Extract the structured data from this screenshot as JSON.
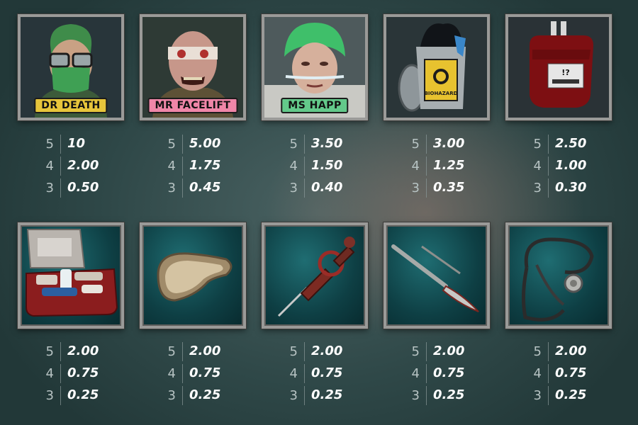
{
  "symbols_row1": [
    {
      "name": "dr-death",
      "label": "DR DEATH",
      "label_color": "#e7c53b",
      "payouts": [
        {
          "count": "5",
          "value": "10"
        },
        {
          "count": "4",
          "value": "2.00"
        },
        {
          "count": "3",
          "value": "0.50"
        }
      ]
    },
    {
      "name": "mr-facelift",
      "label": "MR FACELIFT",
      "label_color": "#ef86a8",
      "payouts": [
        {
          "count": "5",
          "value": "5.00"
        },
        {
          "count": "4",
          "value": "1.75"
        },
        {
          "count": "3",
          "value": "0.45"
        }
      ]
    },
    {
      "name": "ms-happ",
      "label": "MS HAPP",
      "label_color": "#63c98a",
      "payouts": [
        {
          "count": "5",
          "value": "3.50"
        },
        {
          "count": "4",
          "value": "1.50"
        },
        {
          "count": "3",
          "value": "0.40"
        }
      ]
    },
    {
      "name": "biohazard-bin",
      "bin_label": "BIOHAZARD",
      "payouts": [
        {
          "count": "5",
          "value": "3.00"
        },
        {
          "count": "4",
          "value": "1.25"
        },
        {
          "count": "3",
          "value": "0.35"
        }
      ]
    },
    {
      "name": "blood-bag",
      "bag_label": "!?",
      "payouts": [
        {
          "count": "5",
          "value": "2.50"
        },
        {
          "count": "4",
          "value": "1.00"
        },
        {
          "count": "3",
          "value": "0.30"
        }
      ]
    }
  ],
  "symbols_row2": [
    {
      "name": "first-aid-kit",
      "payouts": [
        {
          "count": "5",
          "value": "2.00"
        },
        {
          "count": "4",
          "value": "0.75"
        },
        {
          "count": "3",
          "value": "0.25"
        }
      ]
    },
    {
      "name": "kidney-dish",
      "payouts": [
        {
          "count": "5",
          "value": "2.00"
        },
        {
          "count": "4",
          "value": "0.75"
        },
        {
          "count": "3",
          "value": "0.25"
        }
      ]
    },
    {
      "name": "syringe",
      "payouts": [
        {
          "count": "5",
          "value": "2.00"
        },
        {
          "count": "4",
          "value": "0.75"
        },
        {
          "count": "3",
          "value": "0.25"
        }
      ]
    },
    {
      "name": "scalpel",
      "payouts": [
        {
          "count": "5",
          "value": "2.00"
        },
        {
          "count": "4",
          "value": "0.75"
        },
        {
          "count": "3",
          "value": "0.25"
        }
      ]
    },
    {
      "name": "stethoscope",
      "payouts": [
        {
          "count": "5",
          "value": "2.00"
        },
        {
          "count": "4",
          "value": "0.75"
        },
        {
          "count": "3",
          "value": "0.25"
        }
      ]
    }
  ]
}
